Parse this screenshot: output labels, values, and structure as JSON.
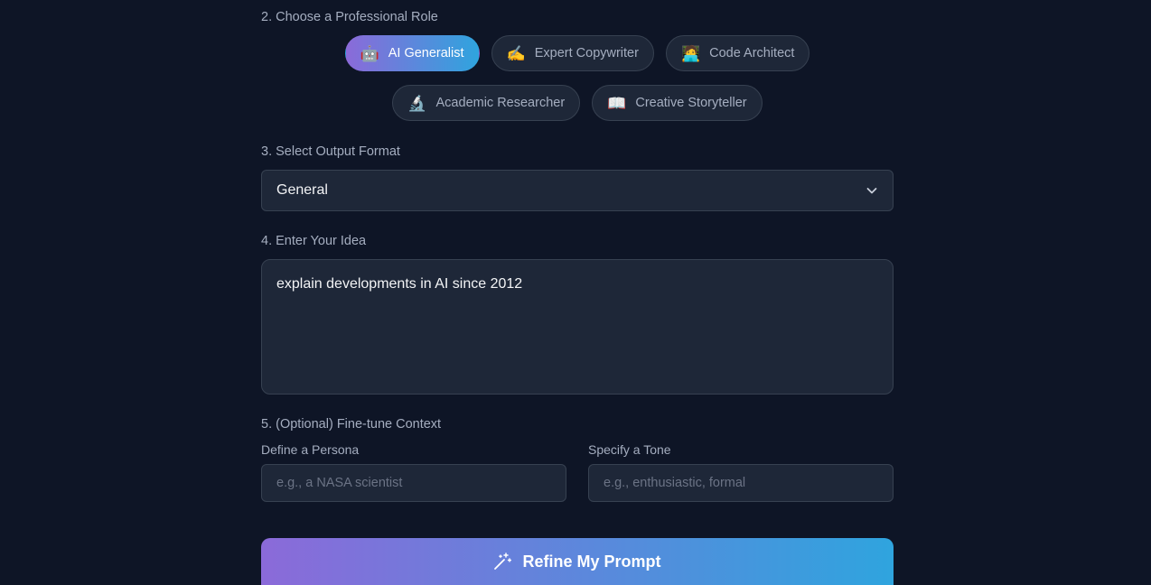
{
  "roles_section": {
    "label": "2. Choose a Professional Role",
    "roles": [
      {
        "emoji": "🤖",
        "label": "AI Generalist",
        "active": true
      },
      {
        "emoji": "✍️",
        "label": "Expert Copywriter",
        "active": false
      },
      {
        "emoji": "🧑‍💻",
        "label": "Code Architect",
        "active": false
      },
      {
        "emoji": "🔬",
        "label": "Academic Researcher",
        "active": false
      },
      {
        "emoji": "📖",
        "label": "Creative Storyteller",
        "active": false
      }
    ]
  },
  "format_section": {
    "label": "3. Select Output Format",
    "selected": "General",
    "icon": "chevron-down-icon"
  },
  "idea_section": {
    "label": "4. Enter Your Idea",
    "value": "explain developments in AI since 2012"
  },
  "context_section": {
    "label": "5. (Optional) Fine-tune Context",
    "persona_label": "Define a Persona",
    "persona_placeholder": "e.g., a NASA scientist",
    "tone_label": "Specify a Tone",
    "tone_placeholder": "e.g., enthusiastic, formal"
  },
  "submit": {
    "label": "Refine My Prompt",
    "icon": "magic-wand-icon"
  },
  "colors": {
    "background": "#0e1526",
    "surface": "#1e2738",
    "border": "#374151",
    "gradient_start": "#8b6ad9",
    "gradient_end": "#2fa4de"
  }
}
